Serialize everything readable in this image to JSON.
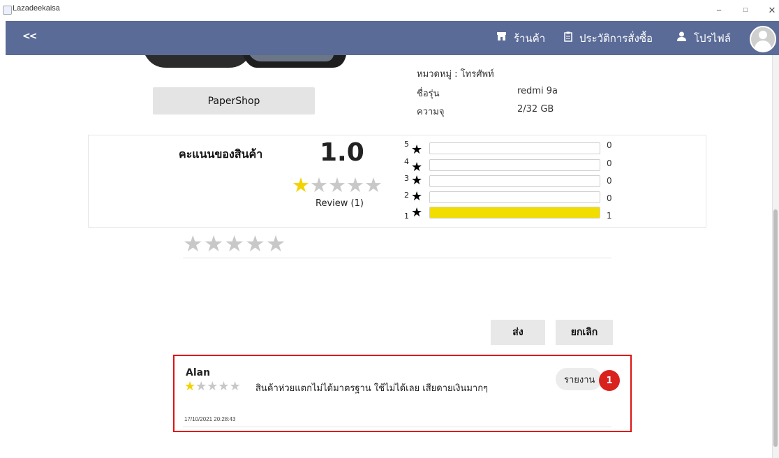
{
  "window": {
    "title": "Lazadeekaisa",
    "minimize": "−",
    "maximize": "□",
    "close": "✕"
  },
  "header": {
    "back": "<<",
    "nav": [
      {
        "label": "ร้านค้า",
        "icon": "store-icon"
      },
      {
        "label": "ประวัติการสั่งซื้อ",
        "icon": "clipboard-icon"
      },
      {
        "label": "โปรไฟล์",
        "icon": "user-icon"
      }
    ]
  },
  "product": {
    "shop_button": "PaperShop",
    "category": "หมวดหมู่ : โทรศัพท์",
    "specs": [
      {
        "label": "ชื่อรุ่น",
        "value": "redmi 9a"
      },
      {
        "label": "ความจุ",
        "value": "2/32 GB"
      }
    ]
  },
  "rating": {
    "title": "คะแนนของสินค้า",
    "score": "1.0",
    "score_stars_filled": 1,
    "review_count": "Review (1)",
    "breakdown": [
      {
        "stars": "5",
        "count": "0",
        "fraction": 0
      },
      {
        "stars": "4",
        "count": "0",
        "fraction": 0
      },
      {
        "stars": "3",
        "count": "0",
        "fraction": 0
      },
      {
        "stars": "2",
        "count": "0",
        "fraction": 0
      },
      {
        "stars": "1",
        "count": "1",
        "fraction": 1
      }
    ],
    "colors": {
      "filled_star": "#f2d300",
      "empty_star": "#c8c8c8",
      "bar_fill": "#f2dd00"
    }
  },
  "review_input": {
    "stars": "★★★★★",
    "send_button": "ส่ง",
    "cancel_button": "ยกเลิก"
  },
  "reviews": [
    {
      "name": "Alan",
      "stars_filled": 1,
      "text": "สินค้าห่วยแตกไม่ได้มาตรฐาน ใช้ไม่ได้เลย เสียดายเงินมากๆ",
      "date": "17/10/2021 20:28:43",
      "report_button": "รายงาน",
      "report_count": "1"
    }
  ],
  "accent": {
    "header": "#5a6b97",
    "highlight": "#e01010",
    "badge": "#d9211e"
  }
}
